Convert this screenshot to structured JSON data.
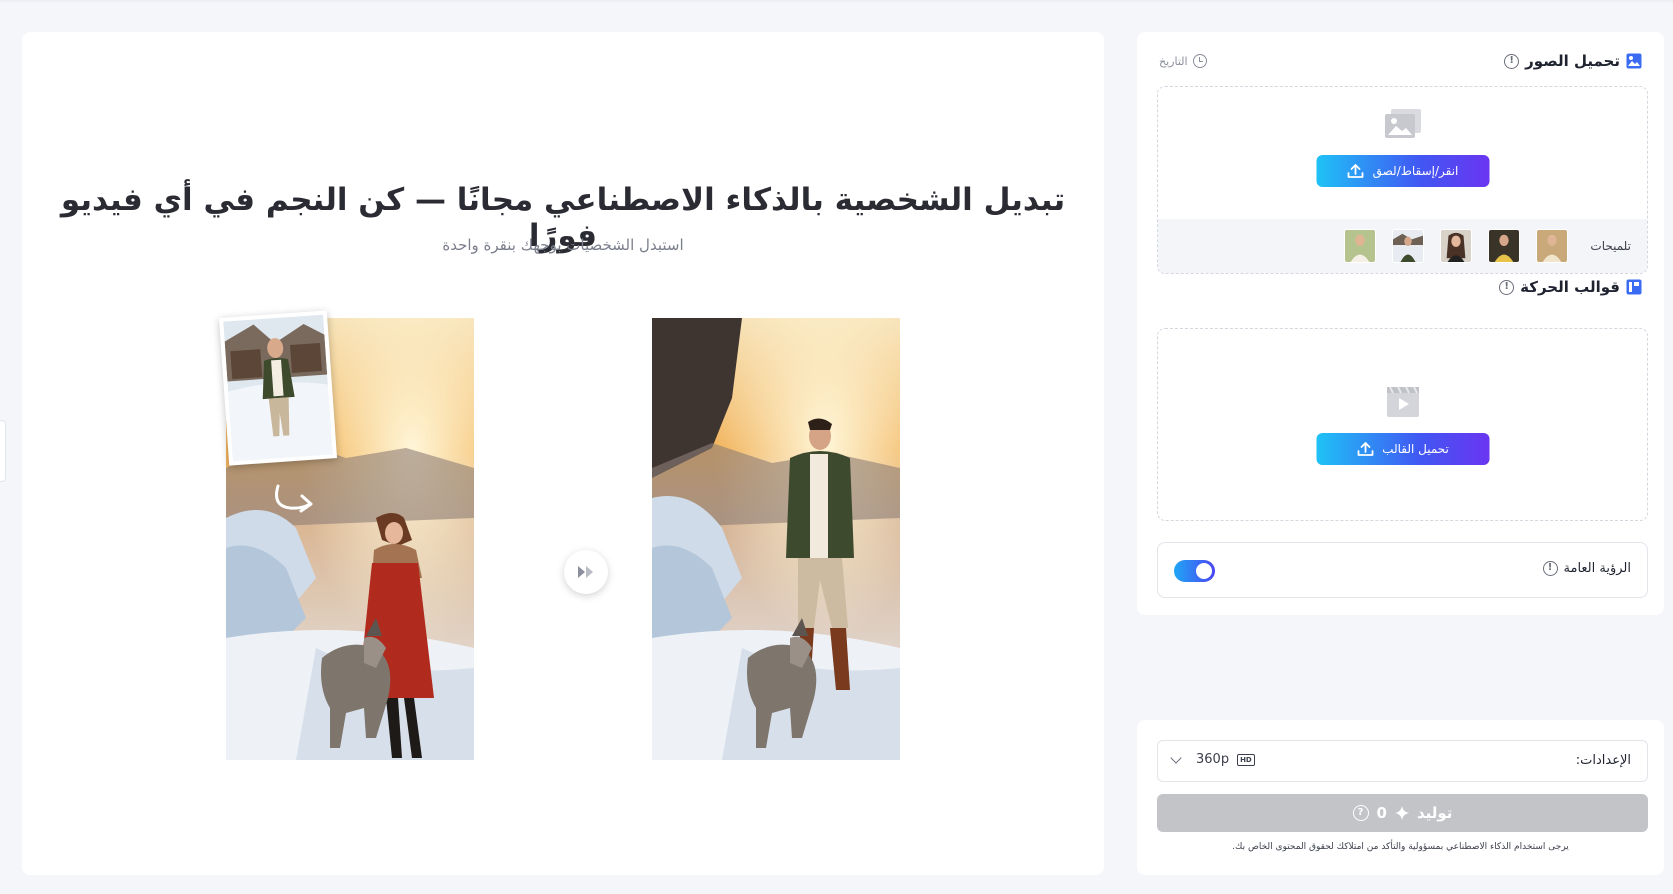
{
  "main": {
    "headline": "تبديل الشخصية بالذكاء الاصطناعي مجانًا — كن النجم في أي فيديو فورًا",
    "subheadline": "استبدل الشخصيات بوجهك بنقرة واحدة"
  },
  "sidebar": {
    "upload_section": {
      "title": "تحميل الصور",
      "history_label": "التاريخ",
      "upload_button_label": "انقر/إسقاط/لصق",
      "hints_label": "تلميحات"
    },
    "template_section": {
      "title": "قوالب الحركة",
      "upload_button_label": "تحميل القالب"
    },
    "public_view": {
      "label": "الرؤية العامة",
      "enabled": true
    }
  },
  "settings": {
    "label": "الإعدادات:",
    "quality_value": "360p",
    "hd_badge": "HD",
    "generate_label": "توليد",
    "generate_cost": "0",
    "disclaimer": "يرجى استخدام الذكاء الاصطناعي بمسؤولية والتأكد من امتلاكك لحقوق المحتوى الخاص بك."
  },
  "colors": {
    "accent_gradient_start": "#1fc2f6",
    "accent_gradient_end": "#6a35f1",
    "disabled_button": "#c3c4c8",
    "page_bg": "#f5f6fa"
  },
  "icons": [
    "image-icon",
    "info-icon",
    "clock-icon",
    "upload-icon",
    "template-icon",
    "video-placeholder-icon",
    "sparkle-icon",
    "question-icon",
    "chevron-down-icon",
    "hd-icon",
    "double-chevron-right-icon",
    "curved-swap-arrow-icon"
  ]
}
